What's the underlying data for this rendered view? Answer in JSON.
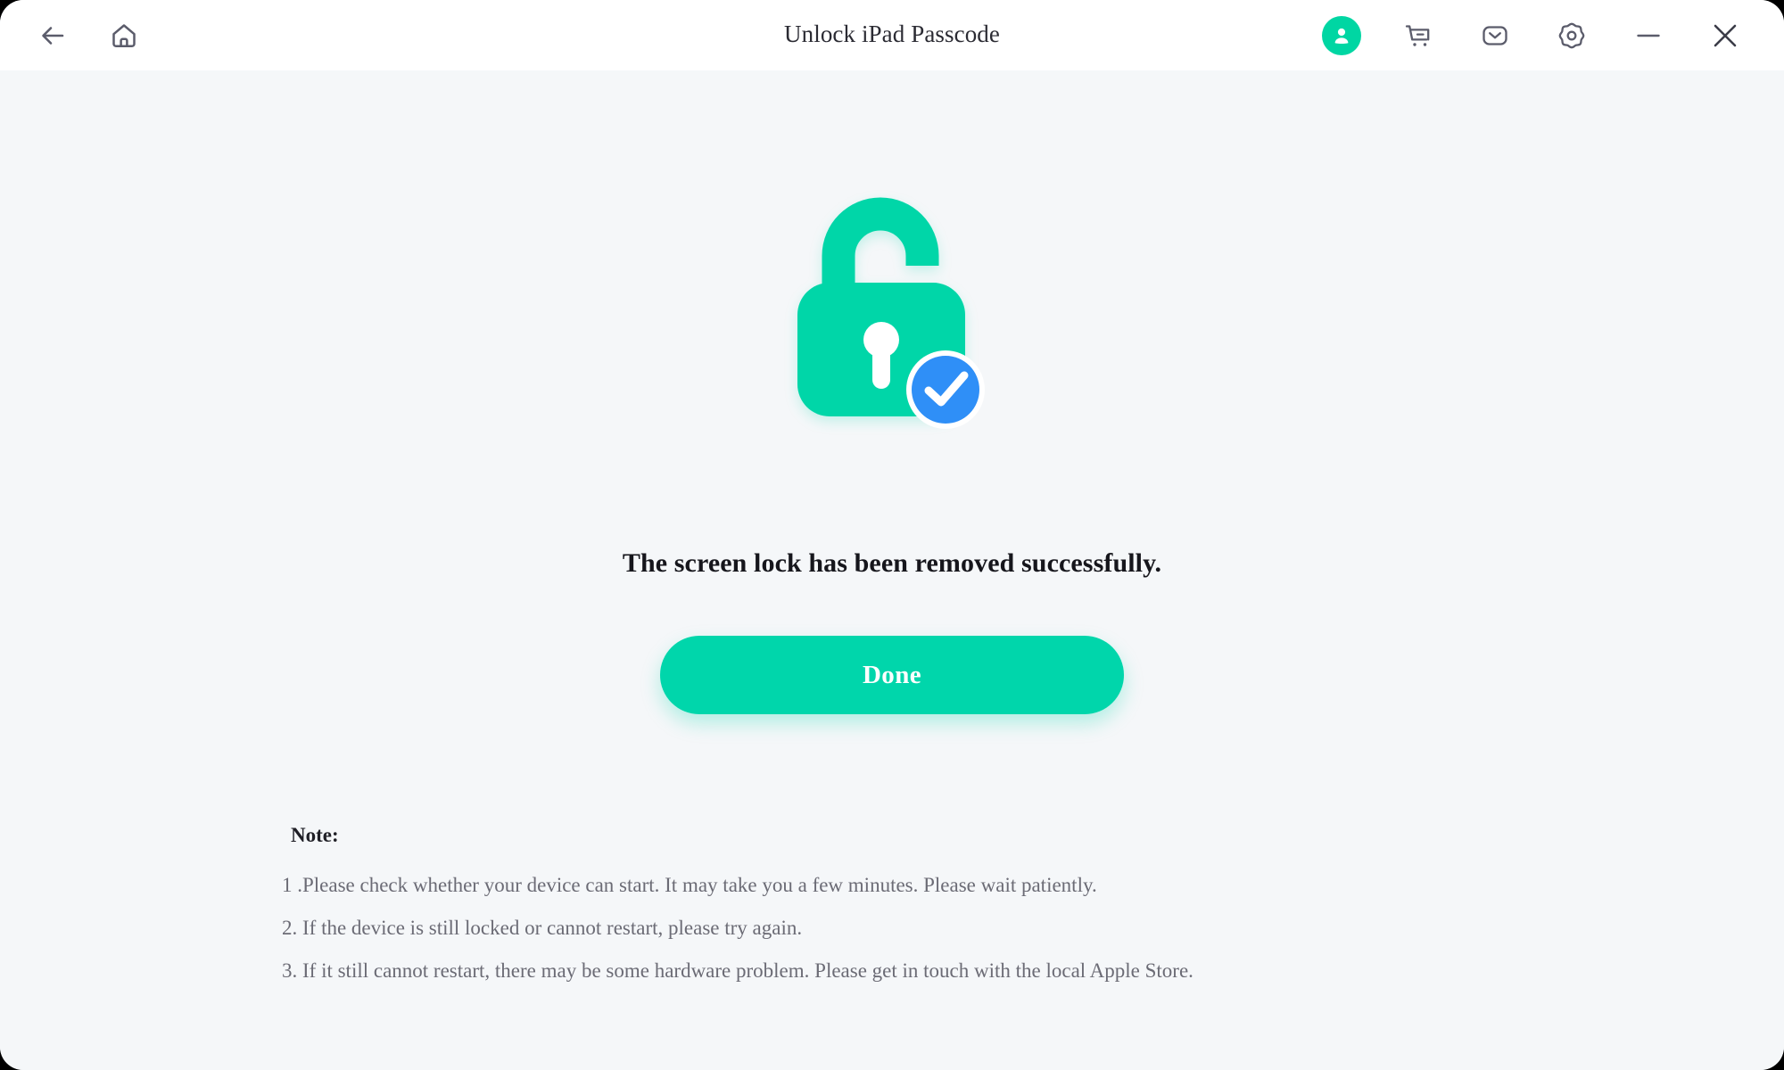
{
  "window": {
    "title": "Unlock iPad Passcode",
    "titlebar_bg": "#ffffff",
    "content_bg": "#f5f7f9"
  },
  "titlebar": {
    "left_icons": [
      {
        "name": "back-arrow-icon",
        "label": "Back"
      },
      {
        "name": "home-icon",
        "label": "Home"
      }
    ],
    "right_icons": [
      {
        "name": "account-icon",
        "label": "Account"
      },
      {
        "name": "cart-icon",
        "label": "Cart"
      },
      {
        "name": "mail-icon",
        "label": "Mail"
      },
      {
        "name": "gear-icon",
        "label": "Settings"
      },
      {
        "name": "minimize-icon",
        "label": "Minimize"
      },
      {
        "name": "close-icon",
        "label": "Close"
      }
    ],
    "account_color": "#00d6a3",
    "icon_color": "#5b5c6b"
  },
  "main": {
    "illustration": {
      "name": "unlocked-padlock-with-check-badge",
      "lock_color": "#00d6a8",
      "badge_color": "#2f8ff7",
      "keyhole_color": "#ffffff"
    },
    "headline": "The screen lock has been removed successfully.",
    "primary_button": {
      "label": "Done",
      "color": "#00d6ab",
      "text_color": "#ffffff"
    },
    "note": {
      "heading": "Note:",
      "lines": [
        "1 .Please check whether your device can start. It may take you a few minutes. Please wait patiently.",
        "2. If the device is still locked or cannot restart, please try again.",
        "3. If it still cannot restart, there may be some hardware problem. Please get in touch with the local Apple Store."
      ]
    }
  }
}
